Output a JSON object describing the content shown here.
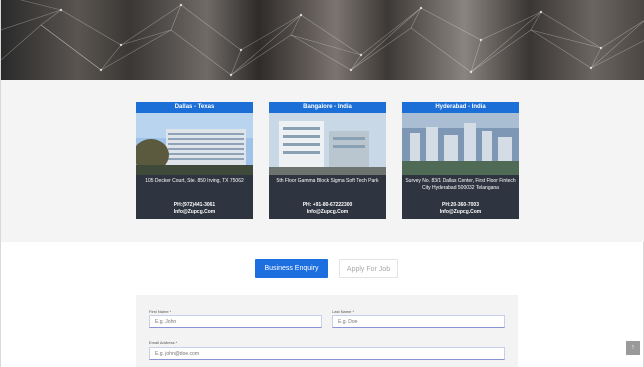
{
  "locations": [
    {
      "title": "Dallas - Texas",
      "address": "105 Decker Court, Ste. 850 Irving, TX 75062",
      "phone": "PH:(972)441-3061",
      "email": "Info@Zupcg.Com"
    },
    {
      "title": "Bangalore - India",
      "address": "5th Floor Gamma Block Sigma Soft Tech Park",
      "phone": "PH: +91-80-67222300",
      "email": "Info@Zupcg.Com"
    },
    {
      "title": "Hyderabad - India",
      "address": "Survey No. 83/1 Dallas Center, First Floor Fintech City Hyderabad 500032 Telangana",
      "phone": "PH:20-360-7003",
      "email": "Info@Zupcg.Com"
    }
  ],
  "tabs": {
    "active": "Business Enquiry",
    "inactive": "Apply For Job"
  },
  "form": {
    "first_name_label": "First Name *",
    "first_name_placeholder": "E.g. John",
    "last_name_label": "Last Name *",
    "last_name_placeholder": "E.g. Doe",
    "email_label": "Email Address *",
    "email_placeholder": "E.g. john@doe.com"
  },
  "scroll_top_icon": "arrow-up-icon",
  "colors": {
    "accent": "#1d6fe0",
    "card_header": "#1c6fd6"
  }
}
